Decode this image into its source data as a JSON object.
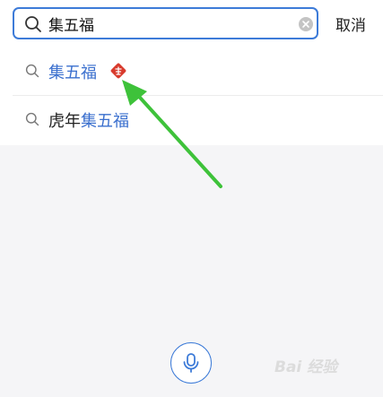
{
  "search": {
    "value": "集五福",
    "cancel_label": "取消"
  },
  "suggestions": [
    {
      "prefix": "",
      "highlight": "集五福",
      "badge_icon": "fu-badge-icon"
    },
    {
      "prefix": "虎年",
      "highlight": "集五福"
    }
  ],
  "watermark": "Bai 经验",
  "colors": {
    "accent": "#3d7bd8",
    "highlight_text": "#3a6fce",
    "badge": "#d83a2c",
    "arrow": "#3ec23a",
    "background": "#f5f5f7"
  },
  "icons": {
    "search": "search-icon",
    "clear": "clear-icon",
    "mic": "microphone-icon"
  }
}
